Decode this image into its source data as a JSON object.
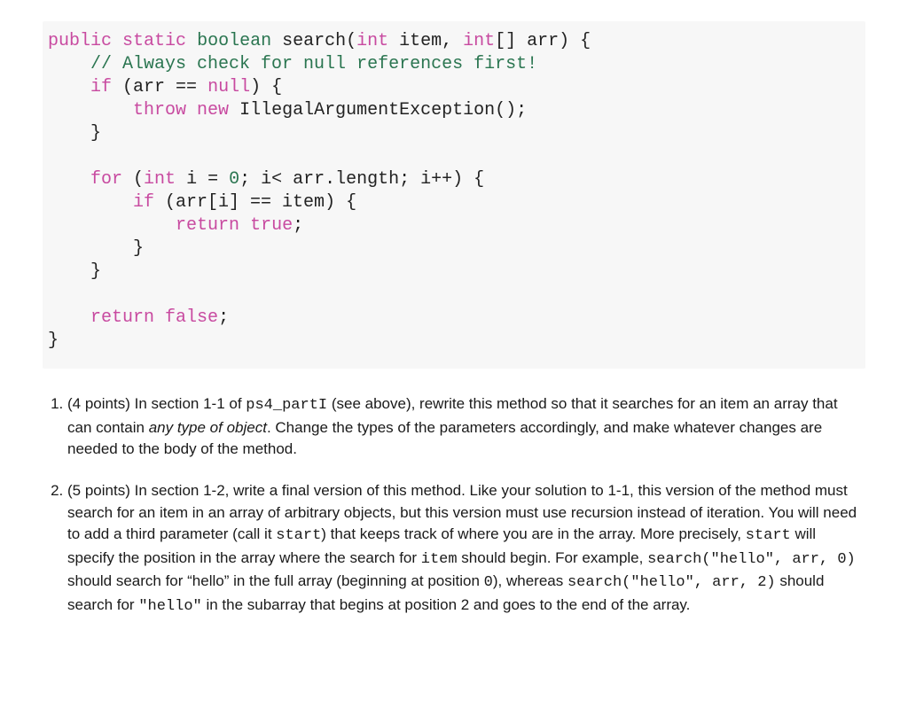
{
  "code": {
    "l1": "public static boolean search(int item, int[] arr) {",
    "l2": "    // Always check for null references first!",
    "l3": "    if (arr == null) {",
    "l4": "        throw new IllegalArgumentException();",
    "l5": "    }",
    "l6": "",
    "l7": "    for (int i = 0; i< arr.length; i++) {",
    "l8": "        if (arr[i] == item) {",
    "l9": "            return true;",
    "l10": "        }",
    "l11": "    }",
    "l12": "",
    "l13": "    return false;",
    "l14": "}"
  },
  "questions": {
    "q1": {
      "points": "(4 points)",
      "t1": " In section 1-1 of ",
      "ps4": "ps4_partI",
      "t2": " (see above), rewrite this method so that it searches for an item an array that can contain ",
      "em": "any type of object",
      "t3": ". Change the types of the parameters accordingly, and make whatever changes are needed to the body of the method."
    },
    "q2": {
      "points": "(5 points)",
      "t1": " In section 1-2, write a final version of this method. Like your solution to 1-1, this version of the method must search for an item in an array of arbitrary objects, but this version must use recursion instead of iteration. You will need to add a third parameter (call it ",
      "start1": "start",
      "t2": ") that keeps track of where you are in the array. More precisely, ",
      "start2": "start",
      "t3": " will specify the position in the array where the search for ",
      "item": "item",
      "t4": " should begin. For example, ",
      "call1": "search(\"hello\", arr, 0)",
      "t5": " should search for “hello” in the full array (beginning at position ",
      "zero": "0",
      "t6": "), whereas ",
      "call2": "search(\"hello\", arr, 2)",
      "t7": " should search for ",
      "hello": "\"hello\"",
      "t8": " in the subarray that begins at position 2 and goes to the end of the array."
    }
  }
}
